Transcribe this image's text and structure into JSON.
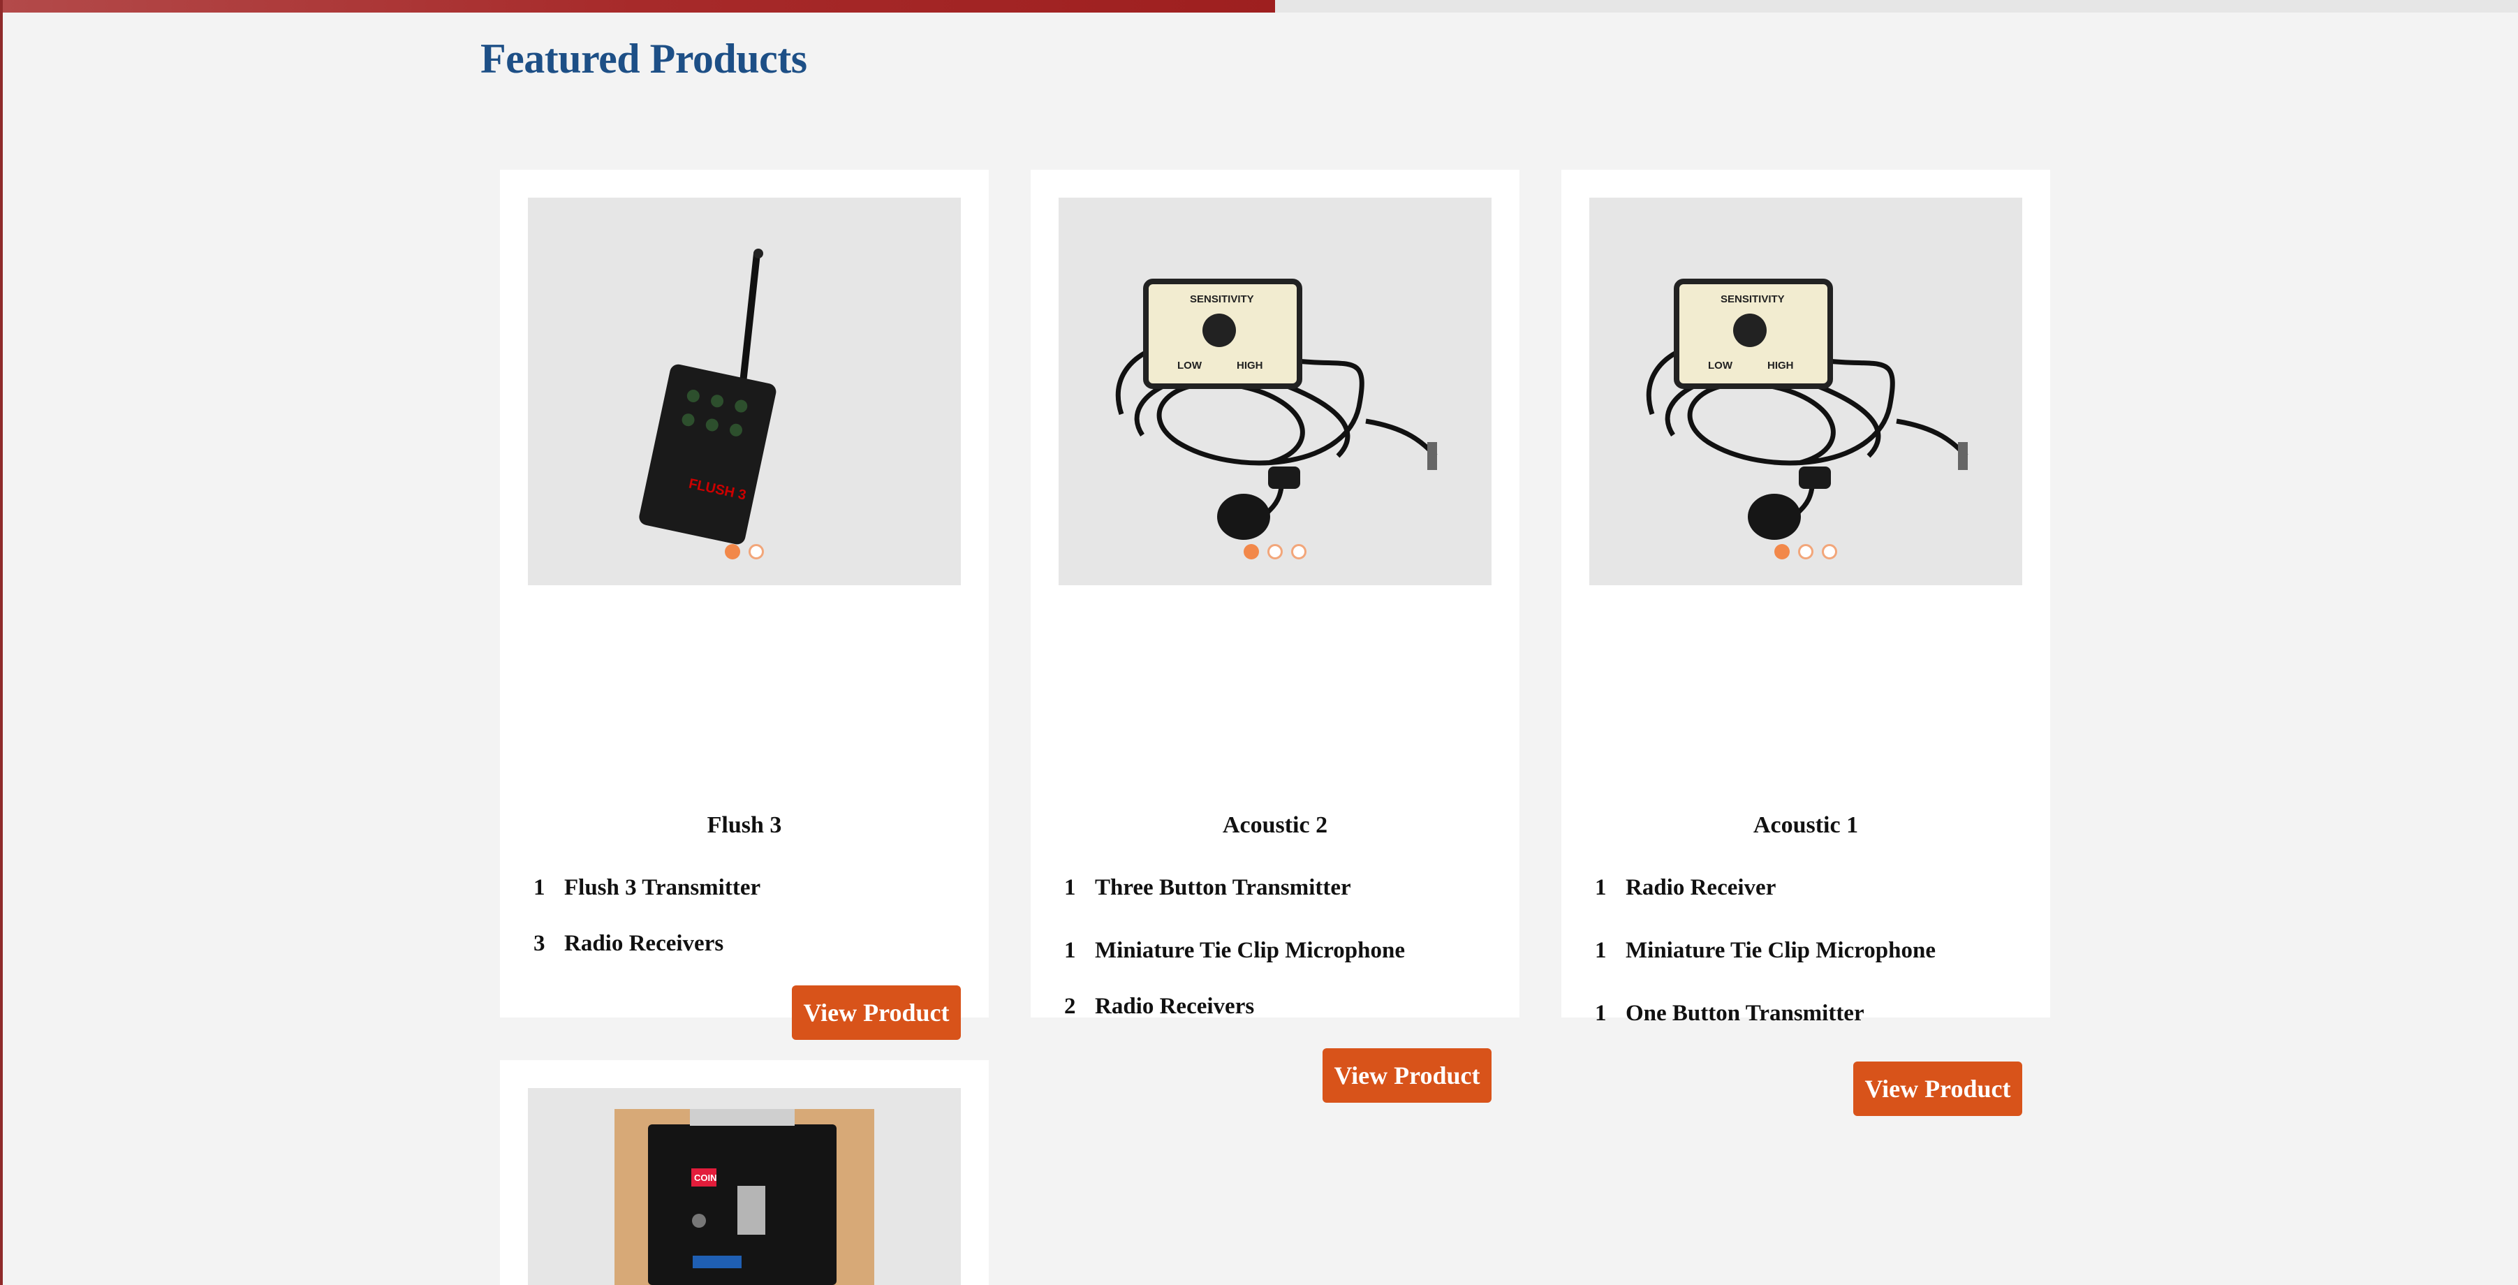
{
  "page": {
    "title": "Featured Products"
  },
  "products": [
    {
      "name": "Flush 3",
      "items": [
        {
          "qty": "1",
          "label": "Flush 3 Transmitter"
        },
        {
          "qty": "3",
          "label": "Radio Receivers"
        }
      ],
      "button": "View Product",
      "carousel": {
        "count": 2,
        "active": 1
      }
    },
    {
      "name": "Acoustic 2",
      "items": [
        {
          "qty": "1",
          "label": "Three Button Transmitter"
        },
        {
          "qty": "1",
          "label": "Miniature Tie Clip Microphone"
        },
        {
          "qty": "2",
          "label": "Radio Receivers"
        }
      ],
      "button": "View Product",
      "carousel": {
        "count": 3,
        "active": 1
      }
    },
    {
      "name": "Acoustic 1",
      "items": [
        {
          "qty": "1",
          "label": "Radio Receiver"
        },
        {
          "qty": "1",
          "label": "Miniature Tie Clip Microphone"
        },
        {
          "qty": "1",
          "label": "One Button Transmitter"
        }
      ],
      "button": "View Product",
      "carousel": {
        "count": 3,
        "active": 1
      }
    }
  ],
  "partial_card": {
    "badge": "COIN"
  },
  "device_labels": {
    "flush3": "FLUSH 3",
    "sensitivity": "SENSITIVITY",
    "low": "LOW",
    "high": "HIGH"
  }
}
